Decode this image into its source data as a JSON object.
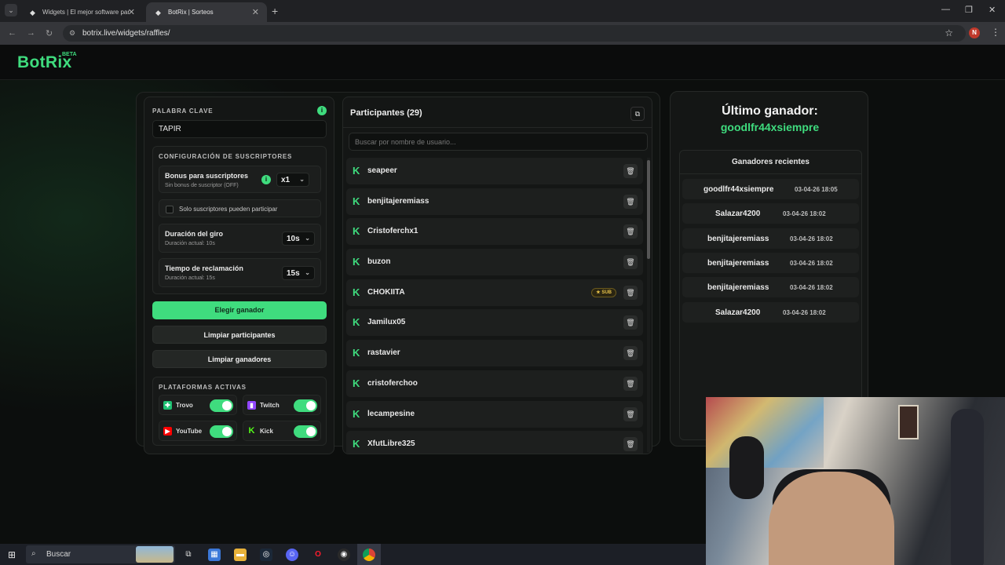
{
  "browser": {
    "tabs": [
      {
        "title": "Widgets | El mejor software par"
      },
      {
        "title": "BotRix | Sorteos"
      }
    ],
    "url": "botrix.live/widgets/raffles/",
    "profile_initial": "N"
  },
  "brand": {
    "logo": "BotRix",
    "badge": "BETA"
  },
  "left": {
    "keyword_label": "PALABRA CLAVE",
    "keyword_value": "TAPIR",
    "subs_title": "CONFIGURACIÓN DE SUSCRIPTORES",
    "bonus_title": "Bonus para suscriptores",
    "bonus_sub": "Sin bonus de suscriptor (OFF)",
    "bonus_value": "x1",
    "only_subs_label": "Solo suscriptores pueden participar",
    "spin_title": "Duración del giro",
    "spin_sub": "Duración actual: 10s",
    "spin_value": "10s",
    "claim_title": "Tiempo de reclamación",
    "claim_sub": "Duración actual: 15s",
    "claim_value": "15s",
    "btn_pick": "Elegir ganador",
    "btn_clear_participants": "Limpiar participantes",
    "btn_clear_winners": "Limpiar ganadores",
    "platforms_title": "PLATAFORMAS ACTIVAS",
    "platforms": [
      {
        "name": "Trovo",
        "enabled": true,
        "color": "#1ec172"
      },
      {
        "name": "Twitch",
        "enabled": true,
        "color": "#9146ff"
      },
      {
        "name": "YouTube",
        "enabled": true,
        "color": "#ff0000"
      },
      {
        "name": "Kick",
        "enabled": true,
        "color": "#53fc18"
      }
    ]
  },
  "participants": {
    "title": "Participantes (29)",
    "search_placeholder": "Buscar por nombre de usuario...",
    "sub_badge": "SUB",
    "items": [
      {
        "name": "seapeer",
        "sub": false
      },
      {
        "name": "benjitajeremiass",
        "sub": false
      },
      {
        "name": "Cristoferchx1",
        "sub": false
      },
      {
        "name": "buzon",
        "sub": false
      },
      {
        "name": "CHOKIITA",
        "sub": true
      },
      {
        "name": "Jamilux05",
        "sub": false
      },
      {
        "name": "rastavier",
        "sub": false
      },
      {
        "name": "cristoferchoo",
        "sub": false
      },
      {
        "name": "lecampesine",
        "sub": false
      },
      {
        "name": "XfutLibre325",
        "sub": false
      }
    ]
  },
  "winners": {
    "last_title": "Último ganador:",
    "last_name": "goodlfr44xsiempre",
    "recent_title": "Ganadores recientes",
    "items": [
      {
        "name": "goodlfr44xsiempre",
        "date": "03-04-26 18:05"
      },
      {
        "name": "Salazar4200",
        "date": "03-04-26 18:02"
      },
      {
        "name": "benjitajeremiass",
        "date": "03-04-26 18:02"
      },
      {
        "name": "benjitajeremiass",
        "date": "03-04-26 18:02"
      },
      {
        "name": "benjitajeremiass",
        "date": "03-04-26 18:02"
      },
      {
        "name": "Salazar4200",
        "date": "03-04-26 18:02"
      }
    ]
  },
  "taskbar": {
    "search_label": "Buscar"
  },
  "colors": {
    "accent": "#3fdc7e",
    "background": "#0c0e0d"
  }
}
